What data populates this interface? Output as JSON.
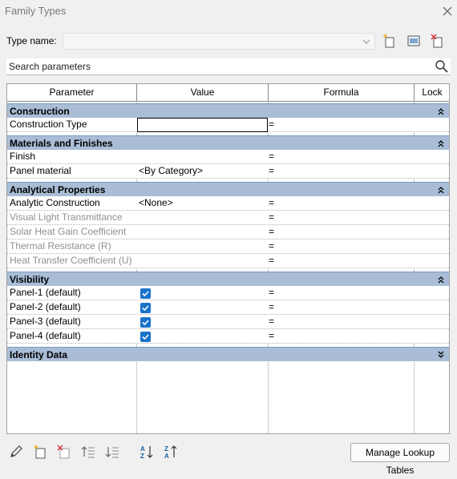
{
  "window": {
    "title": "Family Types"
  },
  "type_name": {
    "label": "Type name:",
    "value": ""
  },
  "search": {
    "placeholder": "Search parameters"
  },
  "columns": {
    "parameter": "Parameter",
    "value": "Value",
    "formula": "Formula",
    "lock": "Lock"
  },
  "groups": {
    "construction": {
      "label": "Construction",
      "rows": [
        {
          "param": "Construction Type",
          "value": "",
          "formula": "="
        }
      ]
    },
    "materials": {
      "label": "Materials and Finishes",
      "rows": [
        {
          "param": "Finish",
          "value": "",
          "formula": "="
        },
        {
          "param": "Panel material",
          "value": "<By Category>",
          "formula": "="
        }
      ]
    },
    "analytical": {
      "label": "Analytical Properties",
      "rows": [
        {
          "param": "Analytic Construction",
          "value": "<None>",
          "formula": "="
        },
        {
          "param": "Visual Light Transmittance",
          "value": "",
          "formula": "="
        },
        {
          "param": "Solar Heat Gain Coefficient",
          "value": "",
          "formula": "="
        },
        {
          "param": "Thermal Resistance (R)",
          "value": "",
          "formula": "="
        },
        {
          "param": "Heat Transfer Coefficient (U)",
          "value": "",
          "formula": "="
        }
      ]
    },
    "visibility": {
      "label": "Visibility",
      "rows": [
        {
          "param": "Panel-1 (default)",
          "checked": true,
          "formula": "="
        },
        {
          "param": "Panel-2 (default)",
          "checked": true,
          "formula": "="
        },
        {
          "param": "Panel-3 (default)",
          "checked": true,
          "formula": "="
        },
        {
          "param": "Panel-4 (default)",
          "checked": true,
          "formula": "="
        }
      ]
    },
    "identity": {
      "label": "Identity Data",
      "rows": []
    }
  },
  "footer": {
    "manage_label": "Manage Lookup Tables"
  },
  "icons": {
    "close": "close-icon",
    "new_type": "new-type-icon",
    "rename_type": "rename-type-icon",
    "delete_type": "delete-type-icon",
    "search": "search-icon",
    "edit_param": "pencil-icon",
    "new_param": "new-parameter-icon",
    "delete_param": "delete-parameter-icon",
    "move_up": "move-up-icon",
    "move_down": "move-down-icon",
    "sort_asc": "sort-ascending-icon",
    "sort_desc": "sort-descending-icon"
  },
  "colors": {
    "group_header": "#a9bdd6",
    "checkbox": "#1a73c9",
    "accent_red": "#d8353b"
  }
}
